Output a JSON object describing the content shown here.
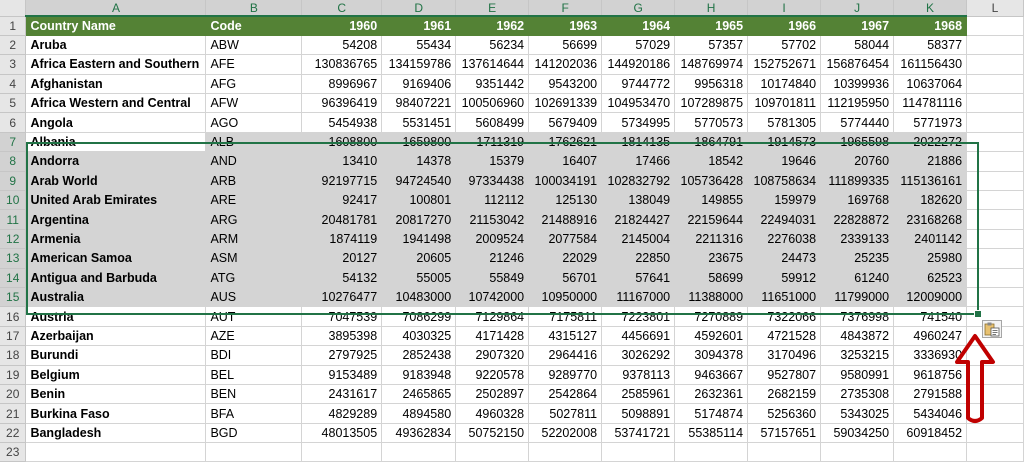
{
  "columns": [
    "A",
    "B",
    "C",
    "D",
    "E",
    "F",
    "G",
    "H",
    "I",
    "J",
    "K",
    "L"
  ],
  "header_row": [
    "Country Name",
    "Code",
    "1960",
    "1961",
    "1962",
    "1963",
    "1964",
    "1965",
    "1966",
    "1967",
    "1968"
  ],
  "rows": [
    [
      "Aruba",
      "ABW",
      "54208",
      "55434",
      "56234",
      "56699",
      "57029",
      "57357",
      "57702",
      "58044",
      "58377"
    ],
    [
      "Africa Eastern and Southern",
      "AFE",
      "130836765",
      "134159786",
      "137614644",
      "141202036",
      "144920186",
      "148769974",
      "152752671",
      "156876454",
      "161156430"
    ],
    [
      "Afghanistan",
      "AFG",
      "8996967",
      "9169406",
      "9351442",
      "9543200",
      "9744772",
      "9956318",
      "10174840",
      "10399936",
      "10637064"
    ],
    [
      "Africa Western and Central",
      "AFW",
      "96396419",
      "98407221",
      "100506960",
      "102691339",
      "104953470",
      "107289875",
      "109701811",
      "112195950",
      "114781116"
    ],
    [
      "Angola",
      "AGO",
      "5454938",
      "5531451",
      "5608499",
      "5679409",
      "5734995",
      "5770573",
      "5781305",
      "5774440",
      "5771973"
    ],
    [
      "Albania",
      "ALB",
      "1608800",
      "1659800",
      "1711319",
      "1762621",
      "1814135",
      "1864791",
      "1914573",
      "1965598",
      "2022272"
    ],
    [
      "Andorra",
      "AND",
      "13410",
      "14378",
      "15379",
      "16407",
      "17466",
      "18542",
      "19646",
      "20760",
      "21886"
    ],
    [
      "Arab World",
      "ARB",
      "92197715",
      "94724540",
      "97334438",
      "100034191",
      "102832792",
      "105736428",
      "108758634",
      "111899335",
      "115136161"
    ],
    [
      "United Arab Emirates",
      "ARE",
      "92417",
      "100801",
      "112112",
      "125130",
      "138049",
      "149855",
      "159979",
      "169768",
      "182620"
    ],
    [
      "Argentina",
      "ARG",
      "20481781",
      "20817270",
      "21153042",
      "21488916",
      "21824427",
      "22159644",
      "22494031",
      "22828872",
      "23168268"
    ],
    [
      "Armenia",
      "ARM",
      "1874119",
      "1941498",
      "2009524",
      "2077584",
      "2145004",
      "2211316",
      "2276038",
      "2339133",
      "2401142"
    ],
    [
      "American Samoa",
      "ASM",
      "20127",
      "20605",
      "21246",
      "22029",
      "22850",
      "23675",
      "24473",
      "25235",
      "25980"
    ],
    [
      "Antigua and Barbuda",
      "ATG",
      "54132",
      "55005",
      "55849",
      "56701",
      "57641",
      "58699",
      "59912",
      "61240",
      "62523"
    ],
    [
      "Australia",
      "AUS",
      "10276477",
      "10483000",
      "10742000",
      "10950000",
      "11167000",
      "11388000",
      "11651000",
      "11799000",
      "12009000"
    ],
    [
      "Austria",
      "AUT",
      "7047539",
      "7086299",
      "7129864",
      "7175811",
      "7223801",
      "7270889",
      "7322066",
      "7376998",
      "741540"
    ],
    [
      "Azerbaijan",
      "AZE",
      "3895398",
      "4030325",
      "4171428",
      "4315127",
      "4456691",
      "4592601",
      "4721528",
      "4843872",
      "4960247"
    ],
    [
      "Burundi",
      "BDI",
      "2797925",
      "2852438",
      "2907320",
      "2964416",
      "3026292",
      "3094378",
      "3170496",
      "3253215",
      "3336930"
    ],
    [
      "Belgium",
      "BEL",
      "9153489",
      "9183948",
      "9220578",
      "9289770",
      "9378113",
      "9463667",
      "9527807",
      "9580991",
      "9618756"
    ],
    [
      "Benin",
      "BEN",
      "2431617",
      "2465865",
      "2502897",
      "2542864",
      "2585961",
      "2632361",
      "2682159",
      "2735308",
      "2791588"
    ],
    [
      "Burkina Faso",
      "BFA",
      "4829289",
      "4894580",
      "4960328",
      "5027811",
      "5098891",
      "5174874",
      "5256360",
      "5343025",
      "5434046"
    ],
    [
      "Bangladesh",
      "BGD",
      "48013505",
      "49362834",
      "50752150",
      "52202008",
      "53741721",
      "55385114",
      "57157651",
      "59034250",
      "60918452"
    ],
    [
      "",
      "",
      "",
      "",
      "",
      "",
      "",
      "",
      "",
      "",
      ""
    ]
  ],
  "selection": {
    "first_row": 7,
    "last_row": 15
  },
  "colors": {
    "header_fill": "#548235",
    "selection_border": "#217346",
    "selection_fill": "#d4d4d4",
    "arrow": "#c00000"
  },
  "icons": {
    "paste_options": "paste-options-icon",
    "annotation_arrow": "red-arrow-icon"
  }
}
